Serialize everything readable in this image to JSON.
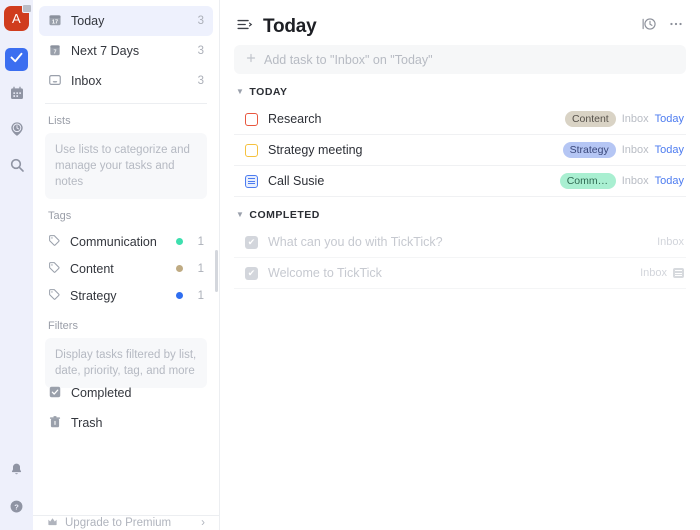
{
  "rail": {
    "avatar_letter": "A",
    "avatar_color": "#d03c1d",
    "items": [
      {
        "name": "tasks",
        "icon": "check-square-icon",
        "active": true
      },
      {
        "name": "calendar",
        "icon": "calendar-icon",
        "active": false
      },
      {
        "name": "pomodoro",
        "icon": "clock-pin-icon",
        "active": false
      },
      {
        "name": "search",
        "icon": "search-icon",
        "active": false
      }
    ],
    "bottom_items": [
      {
        "name": "notifications",
        "icon": "bell-icon"
      },
      {
        "name": "help",
        "icon": "question-circle-icon"
      }
    ]
  },
  "sidebar": {
    "smart_lists": [
      {
        "label": "Today",
        "count": "3",
        "icon": "calendar-17-icon",
        "selected": true
      },
      {
        "label": "Next 7 Days",
        "count": "3",
        "icon": "calendar-7-icon",
        "selected": false
      },
      {
        "label": "Inbox",
        "count": "3",
        "icon": "inbox-tray-icon",
        "selected": false
      }
    ],
    "lists_section": {
      "title": "Lists",
      "placeholder": "Use lists to categorize and manage your tasks and notes"
    },
    "tags_section": {
      "title": "Tags",
      "items": [
        {
          "label": "Communication",
          "count": "1",
          "color": "#3ddfae"
        },
        {
          "label": "Content",
          "count": "1",
          "color": "#bfab83"
        },
        {
          "label": "Strategy",
          "count": "1",
          "color": "#2f6ef0"
        }
      ]
    },
    "filters_section": {
      "title": "Filters",
      "placeholder": "Display tasks filtered by list, date, priority, tag, and more"
    },
    "bottom_items": [
      {
        "label": "Completed",
        "icon": "check-square-filled-icon"
      },
      {
        "label": "Trash",
        "icon": "trash-icon"
      }
    ],
    "upgrade": {
      "label": "Upgrade to Premium",
      "icon": "crown-icon",
      "chevron": "›"
    }
  },
  "main": {
    "title": "Today",
    "view_icon": "list-sort-icon",
    "actions": [
      {
        "name": "timeline-view-button",
        "icon": "clock-timeline-icon"
      },
      {
        "name": "more-options-button",
        "icon": "ellipsis-icon"
      }
    ],
    "add_task": {
      "placeholder": "Add task to \"Inbox\" on \"Today\"",
      "icon": "plus-icon"
    },
    "groups": [
      {
        "label": "TODAY",
        "tasks": [
          {
            "name": "Research",
            "marker": "checkbox",
            "priority": "high",
            "tag": {
              "label": "Content",
              "bg": "#d9d3c5",
              "fg": "#56514a"
            },
            "list": "Inbox",
            "date": "Today",
            "has_note_icon": false
          },
          {
            "name": "Strategy meeting",
            "marker": "checkbox",
            "priority": "medium",
            "tag": {
              "label": "Strategy",
              "bg": "#b5c6f4",
              "fg": "#39477a"
            },
            "list": "Inbox",
            "date": "Today",
            "has_note_icon": false
          },
          {
            "name": "Call Susie",
            "marker": "note",
            "priority": "none",
            "tag": {
              "label": "Commu...",
              "bg": "#a9efd1",
              "fg": "#2f6a52"
            },
            "list": "Inbox",
            "date": "Today",
            "has_note_icon": false
          }
        ]
      },
      {
        "label": "COMPLETED",
        "tasks": [
          {
            "name": "What can you do with TickTick?",
            "marker": "done",
            "check_glyph": "✔",
            "list": "Inbox",
            "date": "",
            "has_note_icon": false
          },
          {
            "name": "Welcome to TickTick",
            "marker": "done",
            "check_glyph": "✔",
            "list": "Inbox",
            "date": "",
            "has_note_icon": true
          }
        ]
      }
    ]
  }
}
